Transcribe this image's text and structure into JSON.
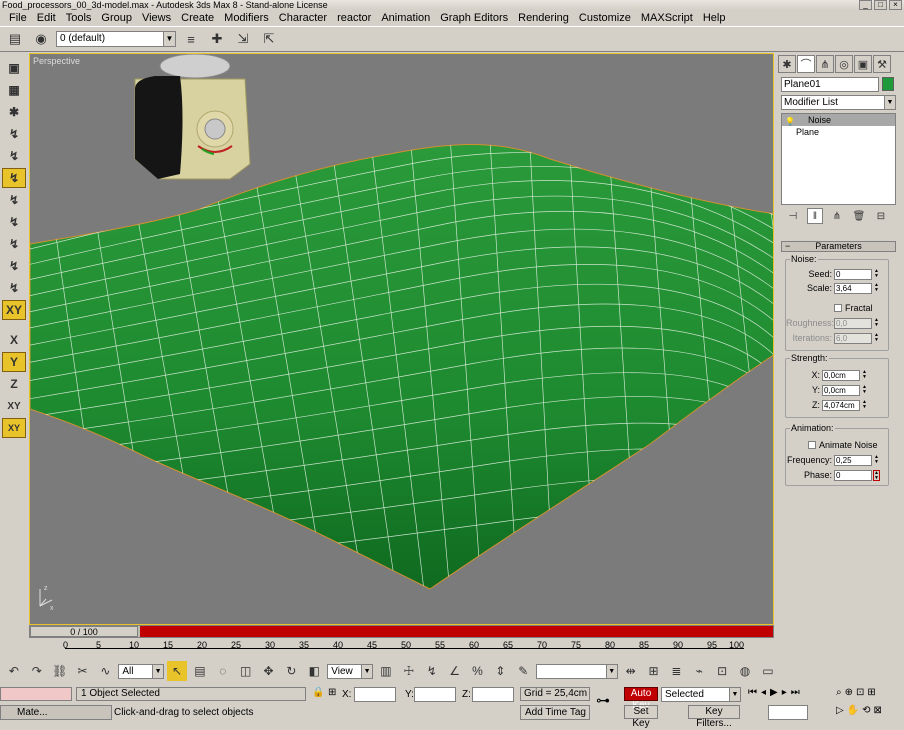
{
  "window": {
    "title": "Food_processors_00_3d-model.max - Autodesk 3ds Max 8 - Stand-alone License"
  },
  "menu": [
    "File",
    "Edit",
    "Tools",
    "Group",
    "Views",
    "Create",
    "Modifiers",
    "Character",
    "reactor",
    "Animation",
    "Graph Editors",
    "Rendering",
    "Customize",
    "MAXScript",
    "Help"
  ],
  "toolbar": {
    "layer": "0 (default)"
  },
  "viewport": {
    "label": "Perspective"
  },
  "left_tools": {
    "x": "X",
    "y": "Y",
    "z": "Z",
    "xy": "XY",
    "xy2": "XY"
  },
  "timeline": {
    "slider": "0 / 100",
    "ticks": [
      "0",
      "5",
      "10",
      "15",
      "20",
      "25",
      "30",
      "35",
      "40",
      "45",
      "50",
      "55",
      "60",
      "65",
      "70",
      "75",
      "80",
      "85",
      "90",
      "95",
      "100"
    ]
  },
  "bottom": {
    "selection_filter": "All",
    "ref_coord": "View",
    "status_selected": "1 Object Selected",
    "prompt": "Click-and-drag to select objects",
    "x_label": "X:",
    "y_label": "Y:",
    "z_label": "Z:",
    "grid": "Grid = 25,4cm",
    "add_time_tag": "Add Time Tag",
    "auto_key": "Auto Key",
    "set_key": "Set Key",
    "key_filter": "Selected",
    "key_filters_btn": "Key Filters...",
    "taskbar_item": "Mate..."
  },
  "command_panel": {
    "object_name": "Plane01",
    "object_color": "#1d9a3a",
    "modifier_list": "Modifier List",
    "stack": [
      "Noise",
      "Plane"
    ],
    "rollout": "Parameters",
    "noise": {
      "title": "Noise:",
      "seed_label": "Seed:",
      "seed": "0",
      "scale_label": "Scale:",
      "scale": "3,64",
      "fractal_label": "Fractal",
      "roughness_label": "Roughness:",
      "roughness": "0,0",
      "iterations_label": "Iterations:",
      "iterations": "6,0"
    },
    "strength": {
      "title": "Strength:",
      "x_label": "X:",
      "x": "0,0cm",
      "y_label": "Y:",
      "y": "0,0cm",
      "z_label": "Z:",
      "z": "4,074cm"
    },
    "animation": {
      "title": "Animation:",
      "animate_label": "Animate Noise",
      "frequency_label": "Frequency:",
      "frequency": "0,25",
      "phase_label": "Phase:",
      "phase": "0"
    }
  }
}
